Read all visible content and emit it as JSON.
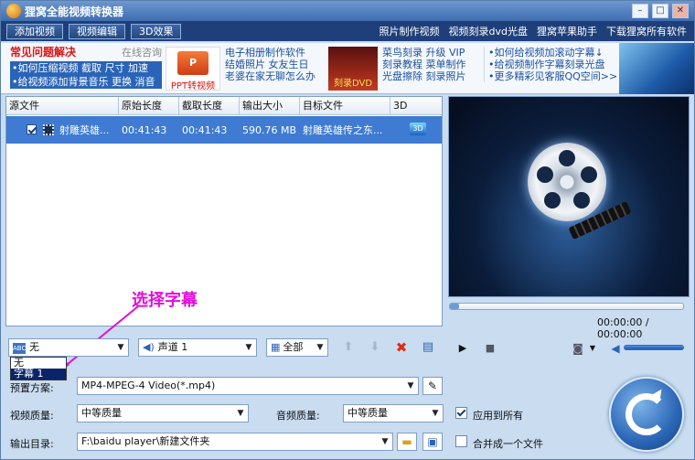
{
  "window": {
    "title": "狸窝全能视频转换器",
    "min": "–",
    "max": "□",
    "close": "✕"
  },
  "menu": {
    "buttons": [
      "添加视频",
      "视频编辑",
      "3D效果"
    ],
    "links": [
      "照片制作视频",
      "视频刻录dvd光盘",
      "狸窝苹果助手",
      "下载狸窝所有软件"
    ]
  },
  "ads": {
    "faq_title": "常见问题解决",
    "faq_online": "在线咨询",
    "faq_items": [
      "•如何压缩视频 截取 尺寸 加速",
      "•给视频添加背景音乐 更换 消音"
    ],
    "ppt_label": "PPT转视频",
    "col2": [
      "电子相册制作软件",
      "结婚照片 女友生日",
      "老婆在家无聊怎么办"
    ],
    "dvd_label": "刻录DVD",
    "col3": [
      "菜鸟刻录 升级 VIP",
      "刻录教程 菜单制作",
      "光盘擦除 刻录照片"
    ],
    "col4": [
      "•如何给视频加滚动字幕↓",
      "•给视频制作字幕刻录光盘",
      "•更多精彩见客服QQ空间>>"
    ]
  },
  "table": {
    "headers": [
      "源文件",
      "原始长度",
      "截取长度",
      "输出大小",
      "目标文件",
      "3D"
    ],
    "rows": [
      {
        "name": "射雕英雄...",
        "orig": "00:41:43",
        "cut": "00:41:43",
        "size": "590.76 MB",
        "target": "射雕英雄传之东..."
      }
    ]
  },
  "annotation": "选择字幕",
  "player": {
    "time": "00:00:00 / 00:00:00"
  },
  "controls": {
    "subtitle_value": "无",
    "subtitle_options": [
      "无",
      "字幕 1"
    ],
    "audio_value": "声道 1",
    "range_value": "全部"
  },
  "settings": {
    "preset_label": "预置方案:",
    "preset_value": "MP4-MPEG-4 Video(*.mp4)",
    "vq_label": "视频质量:",
    "vq_value": "中等质量",
    "aq_label": "音频质量:",
    "aq_value": "中等质量",
    "apply_all": "应用到所有",
    "out_label": "输出目录:",
    "out_value": "F:\\baidu player\\新建文件夹",
    "merge": "合并成一个文件"
  },
  "colors": {
    "accent": "#3f7bd2",
    "annotation": "#e010d8",
    "titlebar": "#3f6db0"
  }
}
